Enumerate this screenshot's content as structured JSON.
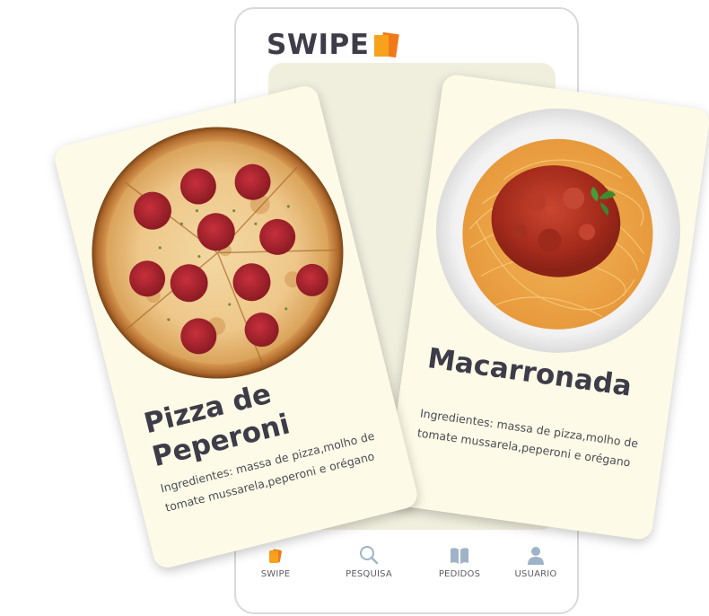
{
  "app": {
    "logo_text": "SWIPE"
  },
  "nav": {
    "items": [
      {
        "label": "SWIPE",
        "icon": "swipe-cards-icon"
      },
      {
        "label": "PESQUISA",
        "icon": "search-icon"
      },
      {
        "label": "PEDIDOS",
        "icon": "book-icon"
      },
      {
        "label": "USUARIO",
        "icon": "user-icon"
      }
    ]
  },
  "cards": {
    "front": {
      "title": "Pizza de Peperoni",
      "description": "Ingredientes: massa de pizza,molho de tomate mussarela,peperoni e orégano",
      "image": "pepperoni-pizza"
    },
    "back": {
      "title": "Macarronada",
      "description": "Ingredientes: massa de pizza,molho de tomate mussarela,peperoni e orégano",
      "image": "spaghetti-bolognese"
    }
  },
  "colors": {
    "card_bg": "#fdfbe7",
    "text_dark": "#3d3c48",
    "brand_orange": "#f07a1a",
    "brand_yellow": "#f6a21c",
    "icon_blue": "#9fb3c8"
  }
}
